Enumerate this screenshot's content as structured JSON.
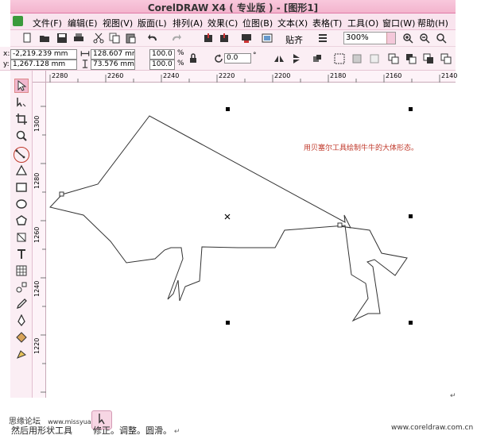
{
  "window": {
    "title": "CorelDRAW X4 ( 专业版 ) - [图形1]"
  },
  "menu": [
    "文件(F)",
    "编辑(E)",
    "视图(V)",
    "版面(L)",
    "排列(A)",
    "效果(C)",
    "位图(B)",
    "文本(X)",
    "表格(T)",
    "工具(O)",
    "窗口(W)",
    "帮助(H)"
  ],
  "toolbar": {
    "snap_label": "贴齐",
    "zoom_value": "300%"
  },
  "propertybar": {
    "x": "-2,219.239 mm",
    "y": "1,267.128 mm",
    "width": "128.607 mm",
    "height": "73.576 mm",
    "scale_x": "100.0",
    "scale_y": "100.0",
    "percent": "%",
    "angle": "0.0",
    "x_label": "x:",
    "y_label": "y:"
  },
  "ruler": {
    "h_ticks": [
      "2280",
      "2260",
      "2240",
      "2220",
      "2200",
      "2180",
      "2160",
      "2140"
    ],
    "v_ticks": [
      "1300",
      "1280",
      "1260",
      "1240",
      "1220"
    ]
  },
  "canvas": {
    "annotation": "用贝塞尔工具绘制牛牛的大体形态。"
  },
  "footer": {
    "left_text": "思缘论坛",
    "left_url": "www.missyuan.com",
    "caption": "然后用形状工具",
    "caption_tail": "修正。调整。圆滑。",
    "right_url": "www.coreldraw.com.cn"
  },
  "colors": {
    "accent_pink": "#f3b4cd",
    "annotation_red": "#c0392b"
  }
}
